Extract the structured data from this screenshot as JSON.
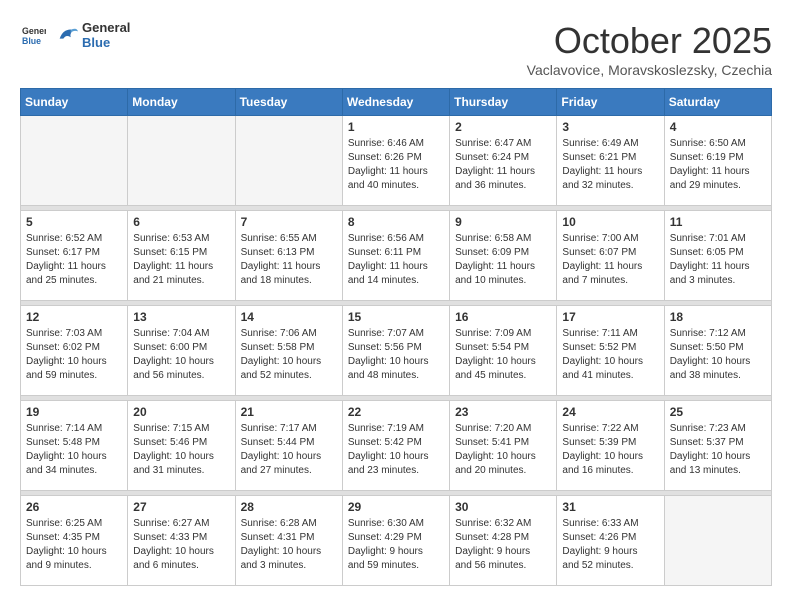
{
  "header": {
    "logo_line1": "General",
    "logo_line2": "Blue",
    "month": "October 2025",
    "location": "Vaclavovice, Moravskoslezsky, Czechia"
  },
  "weekdays": [
    "Sunday",
    "Monday",
    "Tuesday",
    "Wednesday",
    "Thursday",
    "Friday",
    "Saturday"
  ],
  "weeks": [
    [
      {
        "day": "",
        "info": ""
      },
      {
        "day": "",
        "info": ""
      },
      {
        "day": "",
        "info": ""
      },
      {
        "day": "1",
        "info": "Sunrise: 6:46 AM\nSunset: 6:26 PM\nDaylight: 11 hours\nand 40 minutes."
      },
      {
        "day": "2",
        "info": "Sunrise: 6:47 AM\nSunset: 6:24 PM\nDaylight: 11 hours\nand 36 minutes."
      },
      {
        "day": "3",
        "info": "Sunrise: 6:49 AM\nSunset: 6:21 PM\nDaylight: 11 hours\nand 32 minutes."
      },
      {
        "day": "4",
        "info": "Sunrise: 6:50 AM\nSunset: 6:19 PM\nDaylight: 11 hours\nand 29 minutes."
      }
    ],
    [
      {
        "day": "5",
        "info": "Sunrise: 6:52 AM\nSunset: 6:17 PM\nDaylight: 11 hours\nand 25 minutes."
      },
      {
        "day": "6",
        "info": "Sunrise: 6:53 AM\nSunset: 6:15 PM\nDaylight: 11 hours\nand 21 minutes."
      },
      {
        "day": "7",
        "info": "Sunrise: 6:55 AM\nSunset: 6:13 PM\nDaylight: 11 hours\nand 18 minutes."
      },
      {
        "day": "8",
        "info": "Sunrise: 6:56 AM\nSunset: 6:11 PM\nDaylight: 11 hours\nand 14 minutes."
      },
      {
        "day": "9",
        "info": "Sunrise: 6:58 AM\nSunset: 6:09 PM\nDaylight: 11 hours\nand 10 minutes."
      },
      {
        "day": "10",
        "info": "Sunrise: 7:00 AM\nSunset: 6:07 PM\nDaylight: 11 hours\nand 7 minutes."
      },
      {
        "day": "11",
        "info": "Sunrise: 7:01 AM\nSunset: 6:05 PM\nDaylight: 11 hours\nand 3 minutes."
      }
    ],
    [
      {
        "day": "12",
        "info": "Sunrise: 7:03 AM\nSunset: 6:02 PM\nDaylight: 10 hours\nand 59 minutes."
      },
      {
        "day": "13",
        "info": "Sunrise: 7:04 AM\nSunset: 6:00 PM\nDaylight: 10 hours\nand 56 minutes."
      },
      {
        "day": "14",
        "info": "Sunrise: 7:06 AM\nSunset: 5:58 PM\nDaylight: 10 hours\nand 52 minutes."
      },
      {
        "day": "15",
        "info": "Sunrise: 7:07 AM\nSunset: 5:56 PM\nDaylight: 10 hours\nand 48 minutes."
      },
      {
        "day": "16",
        "info": "Sunrise: 7:09 AM\nSunset: 5:54 PM\nDaylight: 10 hours\nand 45 minutes."
      },
      {
        "day": "17",
        "info": "Sunrise: 7:11 AM\nSunset: 5:52 PM\nDaylight: 10 hours\nand 41 minutes."
      },
      {
        "day": "18",
        "info": "Sunrise: 7:12 AM\nSunset: 5:50 PM\nDaylight: 10 hours\nand 38 minutes."
      }
    ],
    [
      {
        "day": "19",
        "info": "Sunrise: 7:14 AM\nSunset: 5:48 PM\nDaylight: 10 hours\nand 34 minutes."
      },
      {
        "day": "20",
        "info": "Sunrise: 7:15 AM\nSunset: 5:46 PM\nDaylight: 10 hours\nand 31 minutes."
      },
      {
        "day": "21",
        "info": "Sunrise: 7:17 AM\nSunset: 5:44 PM\nDaylight: 10 hours\nand 27 minutes."
      },
      {
        "day": "22",
        "info": "Sunrise: 7:19 AM\nSunset: 5:42 PM\nDaylight: 10 hours\nand 23 minutes."
      },
      {
        "day": "23",
        "info": "Sunrise: 7:20 AM\nSunset: 5:41 PM\nDaylight: 10 hours\nand 20 minutes."
      },
      {
        "day": "24",
        "info": "Sunrise: 7:22 AM\nSunset: 5:39 PM\nDaylight: 10 hours\nand 16 minutes."
      },
      {
        "day": "25",
        "info": "Sunrise: 7:23 AM\nSunset: 5:37 PM\nDaylight: 10 hours\nand 13 minutes."
      }
    ],
    [
      {
        "day": "26",
        "info": "Sunrise: 6:25 AM\nSunset: 4:35 PM\nDaylight: 10 hours\nand 9 minutes."
      },
      {
        "day": "27",
        "info": "Sunrise: 6:27 AM\nSunset: 4:33 PM\nDaylight: 10 hours\nand 6 minutes."
      },
      {
        "day": "28",
        "info": "Sunrise: 6:28 AM\nSunset: 4:31 PM\nDaylight: 10 hours\nand 3 minutes."
      },
      {
        "day": "29",
        "info": "Sunrise: 6:30 AM\nSunset: 4:29 PM\nDaylight: 9 hours\nand 59 minutes."
      },
      {
        "day": "30",
        "info": "Sunrise: 6:32 AM\nSunset: 4:28 PM\nDaylight: 9 hours\nand 56 minutes."
      },
      {
        "day": "31",
        "info": "Sunrise: 6:33 AM\nSunset: 4:26 PM\nDaylight: 9 hours\nand 52 minutes."
      },
      {
        "day": "",
        "info": ""
      }
    ]
  ]
}
